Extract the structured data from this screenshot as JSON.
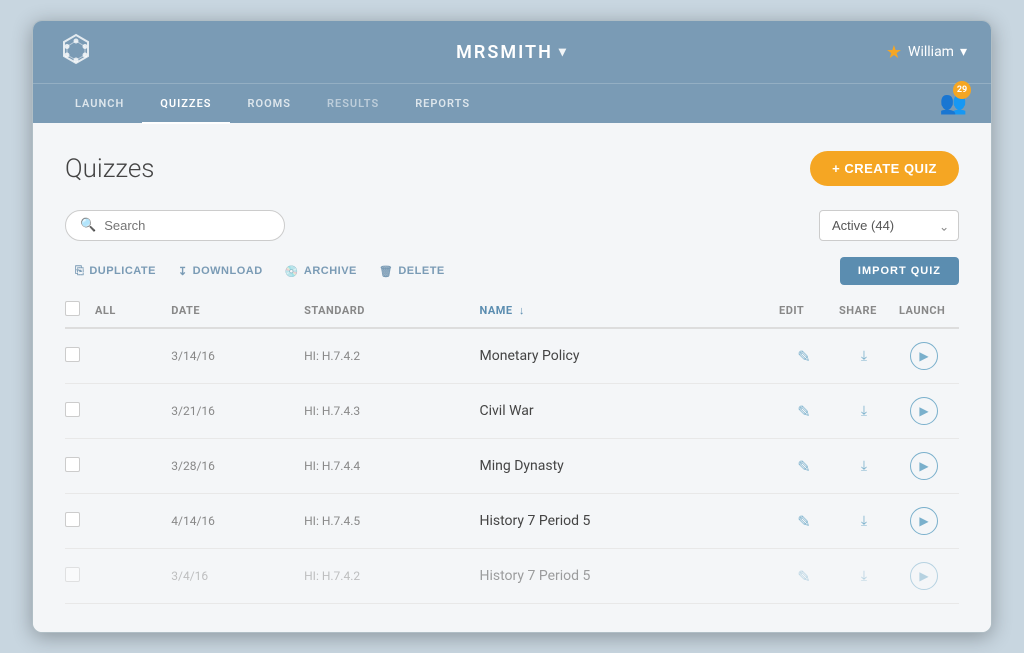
{
  "header": {
    "title": "MRSMITH",
    "title_chevron": "▾",
    "user_name": "William",
    "user_chevron": "▾",
    "badge_count": "29"
  },
  "nav": {
    "tabs": [
      {
        "label": "LAUNCH",
        "active": false
      },
      {
        "label": "QUIZZES",
        "active": true
      },
      {
        "label": "ROOMS",
        "active": false
      },
      {
        "label": "RESULTS",
        "active": false
      },
      {
        "label": "REPORTS",
        "active": false
      }
    ]
  },
  "page": {
    "title": "Quizzes",
    "create_btn": "+ CREATE QUIZ"
  },
  "search": {
    "placeholder": "Search"
  },
  "filter": {
    "value": "Active (44)"
  },
  "toolbar": {
    "duplicate": "DUPLICATE",
    "download": "DOWNLOAD",
    "archive": "ARCHIVE",
    "delete": "DELETE",
    "import": "IMPORT QUIZ"
  },
  "table": {
    "columns": [
      "ALL",
      "DATE",
      "STANDARD",
      "NAME",
      "EDIT",
      "SHARE",
      "LAUNCH"
    ],
    "rows": [
      {
        "date": "3/14/16",
        "standard": "HI: H.7.4.2",
        "name": "Monetary Policy"
      },
      {
        "date": "3/21/16",
        "standard": "HI: H.7.4.3",
        "name": "Civil War"
      },
      {
        "date": "3/28/16",
        "standard": "HI: H.7.4.4",
        "name": "Ming Dynasty"
      },
      {
        "date": "4/14/16",
        "standard": "HI: H.7.4.5",
        "name": "History 7  Period 5"
      },
      {
        "date": "3/4/16",
        "standard": "HI: H.7.4.2",
        "name": "History 7  Period 5",
        "faded": true
      }
    ]
  }
}
